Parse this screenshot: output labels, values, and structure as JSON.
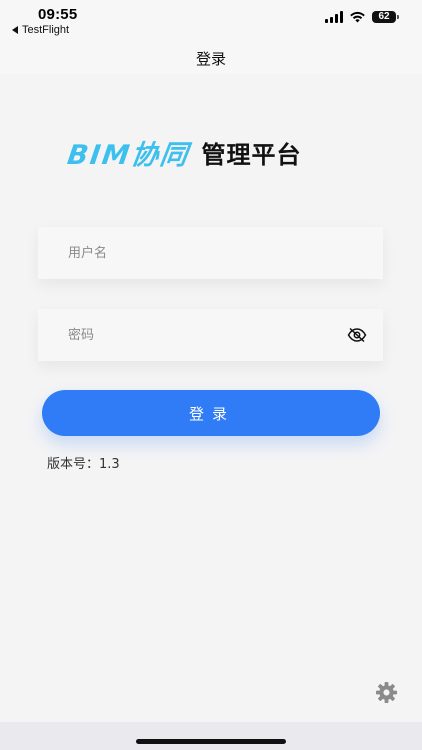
{
  "status_bar": {
    "time": "09:55",
    "back_app": "TestFlight",
    "battery": "62"
  },
  "nav": {
    "title": "登录"
  },
  "logo": {
    "part1": "BIM协同",
    "part2": "管理平台",
    "part1_color": "#3ec0ee"
  },
  "form": {
    "username_placeholder": "用户名",
    "password_placeholder": "密码",
    "password_toggle_icon": "eye-slash-icon",
    "login_label": "登录"
  },
  "version": {
    "label": "版本号：",
    "value": "1.3"
  },
  "footer": {
    "settings_icon": "gear-icon"
  },
  "colors": {
    "primary": "#2f7cf6",
    "background": "#f4f4f5"
  }
}
